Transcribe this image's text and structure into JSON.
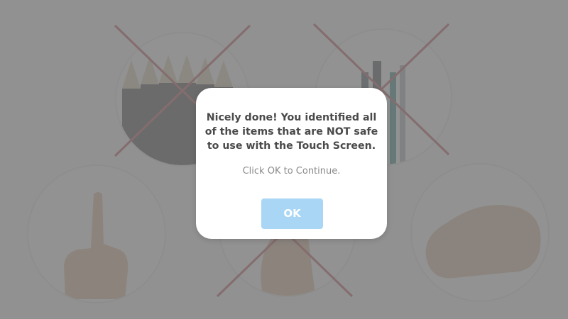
{
  "dialog": {
    "message": "Nicely done! You identified all of the items that are NOT safe to use with the Touch Screen.",
    "instruction": "Click OK to Continue.",
    "ok_label": "OK"
  },
  "items": [
    {
      "name": "pencils",
      "safe": false
    },
    {
      "name": "pens",
      "safe": false
    },
    {
      "name": "finger",
      "safe": true
    },
    {
      "name": "fingernail",
      "safe": false
    },
    {
      "name": "fist",
      "safe": true
    }
  ],
  "colors": {
    "accent_button": "#a9d6f5",
    "cross_mark": "#b5404a",
    "dialog_text": "#4a4a4a",
    "overlay": "#7f7f7f"
  }
}
